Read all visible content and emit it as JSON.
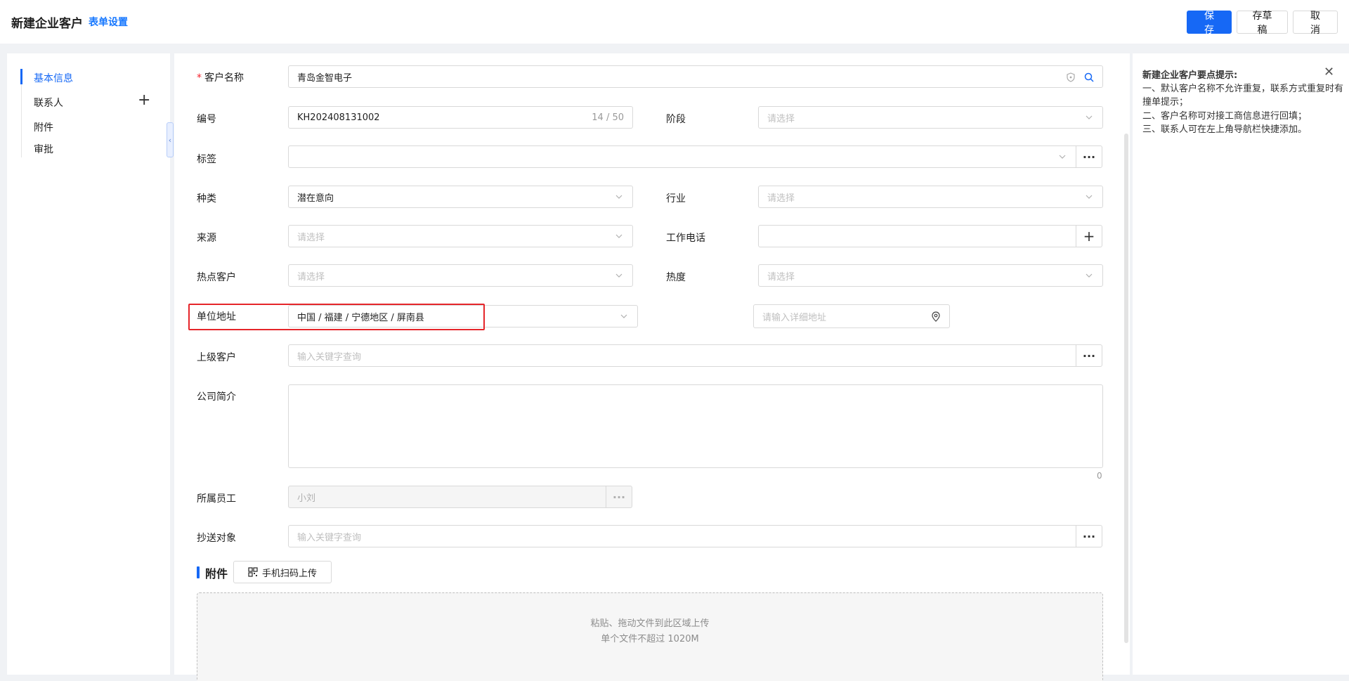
{
  "header": {
    "title": "新建企业客户",
    "form_settings": "表单设置",
    "save": "保 存",
    "draft": "存草稿",
    "cancel": "取 消"
  },
  "sidebar": {
    "items": [
      {
        "label": "基本信息",
        "active": true
      },
      {
        "label": "联系人"
      },
      {
        "label": "附件"
      },
      {
        "label": "审批"
      }
    ],
    "add_icon": "plus-icon"
  },
  "form": {
    "customer_name": {
      "label": "客户名称",
      "required": true,
      "value": "青岛金智电子"
    },
    "code": {
      "label": "编号",
      "value": "KH202408131002",
      "counter": "14 / 50"
    },
    "stage": {
      "label": "阶段",
      "placeholder": "请选择"
    },
    "tags": {
      "label": "标签"
    },
    "category": {
      "label": "种类",
      "value": "潜在意向"
    },
    "industry": {
      "label": "行业",
      "placeholder": "请选择"
    },
    "source": {
      "label": "来源",
      "placeholder": "请选择"
    },
    "work_phone": {
      "label": "工作电话"
    },
    "hot_customer": {
      "label": "热点客户",
      "placeholder": "请选择"
    },
    "heat": {
      "label": "热度",
      "placeholder": "请选择"
    },
    "address": {
      "label": "单位地址",
      "value": "中国 / 福建 / 宁德地区 / 屏南县",
      "detail_placeholder": "请输入详细地址"
    },
    "parent_customer": {
      "label": "上级客户",
      "placeholder": "输入关键字查询"
    },
    "intro": {
      "label": "公司简介",
      "count": "0"
    },
    "employee": {
      "label": "所属员工",
      "value": "小刘"
    },
    "cc": {
      "label": "抄送对象",
      "placeholder": "输入关键字查询"
    }
  },
  "attachments": {
    "title": "附件",
    "scan_button": "手机扫码上传",
    "drop_line1": "粘贴、拖动文件到此区域上传",
    "drop_line2": "单个文件不超过 1020M"
  },
  "tips": {
    "title": "新建企业客户要点提示:",
    "lines": [
      "一、默认客户名称不允许重复，联系方式重复时有撞单提示；",
      "二、客户名称可对接工商信息进行回填；",
      "三、联系人可在左上角导航栏快捷添加。"
    ]
  },
  "colors": {
    "primary": "#1668f5",
    "highlight": "#e5252a"
  }
}
